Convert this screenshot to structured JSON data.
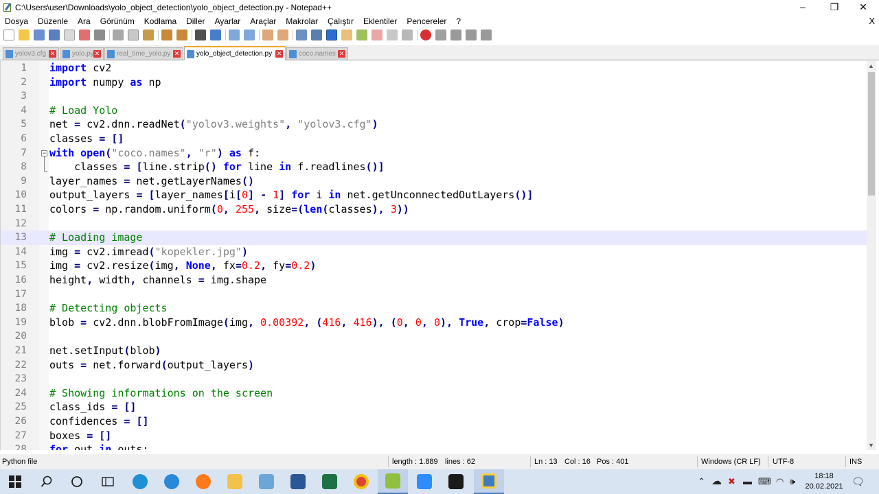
{
  "window": {
    "title": "C:\\Users\\user\\Downloads\\yolo_object_detection\\yolo_object_detection.py - Notepad++",
    "minimize": "–",
    "restore": "❐",
    "close": "✕"
  },
  "menu": {
    "items": [
      "Dosya",
      "Düzenle",
      "Ara",
      "Görünüm",
      "Kodlama",
      "Diller",
      "Ayarlar",
      "Araçlar",
      "Makrolar",
      "Çalıştır",
      "Eklentiler",
      "Pencereler",
      "?"
    ],
    "close_doc": "X"
  },
  "tabs": [
    {
      "label": "yolov3.cfg",
      "active": false
    },
    {
      "label": "yolo.py",
      "active": false
    },
    {
      "label": "real_time_yolo.py",
      "active": false
    },
    {
      "label": "yolo_object_detection.py",
      "active": true
    },
    {
      "label": "coco.names",
      "active": false
    }
  ],
  "editor": {
    "current_line": 13,
    "lines": [
      {
        "n": "1",
        "text": "import cv2"
      },
      {
        "n": "2",
        "text": "import numpy as np"
      },
      {
        "n": "3",
        "text": ""
      },
      {
        "n": "4",
        "text": "# Load Yolo"
      },
      {
        "n": "5",
        "text": "net = cv2.dnn.readNet(\"yolov3.weights\", \"yolov3.cfg\")"
      },
      {
        "n": "6",
        "text": "classes = []"
      },
      {
        "n": "7",
        "text": "with open(\"coco.names\", \"r\") as f:"
      },
      {
        "n": "8",
        "text": "    classes = [line.strip() for line in f.readlines()]"
      },
      {
        "n": "9",
        "text": "layer_names = net.getLayerNames()"
      },
      {
        "n": "10",
        "text": "output_layers = [layer_names[i[0] - 1] for i in net.getUnconnectedOutLayers()]"
      },
      {
        "n": "11",
        "text": "colors = np.random.uniform(0, 255, size=(len(classes), 3))"
      },
      {
        "n": "12",
        "text": ""
      },
      {
        "n": "13",
        "text": "# Loading image"
      },
      {
        "n": "14",
        "text": "img = cv2.imread(\"kopekler.jpg\")"
      },
      {
        "n": "15",
        "text": "img = cv2.resize(img, None, fx=0.2, fy=0.2)"
      },
      {
        "n": "16",
        "text": "height, width, channels = img.shape"
      },
      {
        "n": "17",
        "text": ""
      },
      {
        "n": "18",
        "text": "# Detecting objects"
      },
      {
        "n": "19",
        "text": "blob = cv2.dnn.blobFromImage(img, 0.00392, (416, 416), (0, 0, 0), True, crop=False)"
      },
      {
        "n": "20",
        "text": ""
      },
      {
        "n": "21",
        "text": "net.setInput(blob)"
      },
      {
        "n": "22",
        "text": "outs = net.forward(output_layers)"
      },
      {
        "n": "23",
        "text": ""
      },
      {
        "n": "24",
        "text": "# Showing informations on the screen"
      },
      {
        "n": "25",
        "text": "class_ids = []"
      },
      {
        "n": "26",
        "text": "confidences = []"
      },
      {
        "n": "27",
        "text": "boxes = []"
      },
      {
        "n": "28",
        "text": "for out in outs:"
      }
    ]
  },
  "status": {
    "language": "Python file",
    "length": "length : 1.889",
    "lines": "lines : 62",
    "ln": "Ln : 13",
    "col": "Col : 16",
    "pos": "Pos : 401",
    "eol": "Windows (CR LF)",
    "encoding": "UTF-8",
    "mode": "INS"
  },
  "taskbar": {
    "apps": [
      "start",
      "search",
      "cortana",
      "task-view",
      "edge",
      "internet-explorer",
      "firefox",
      "file-explorer",
      "notepad",
      "word",
      "excel",
      "chrome",
      "notepad-plus-plus",
      "zoom",
      "terminal",
      "python"
    ],
    "clock_time": "18:18",
    "clock_date": "20.02.2021"
  },
  "colors": {
    "keyword": "#0000ff",
    "string": "#808080",
    "number": "#ff0000",
    "comment": "#008000",
    "current_line": "#e8e8ff",
    "taskbar": "#d9e4f2"
  }
}
